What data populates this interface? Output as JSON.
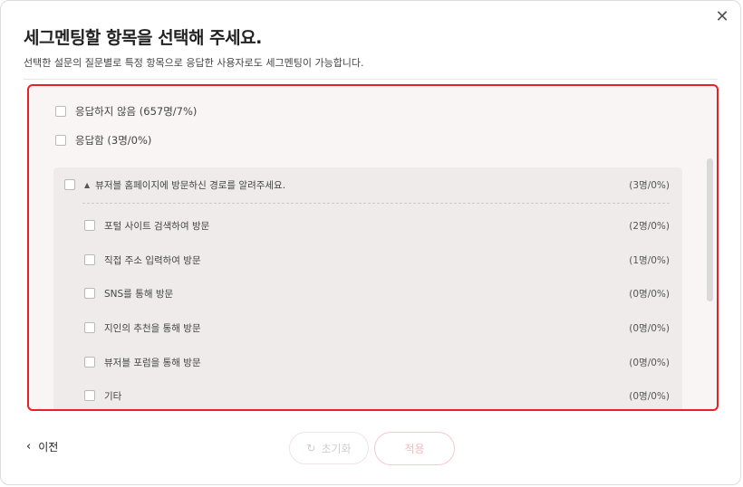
{
  "dialog": {
    "title": "세그멘팅할 항목을 선택해 주세요.",
    "subtitle": "선택한 설문의 질문별로 특정 항목으로 응답한 사용자로도 세그멘팅이 가능합니다.",
    "close_icon": "close-icon"
  },
  "options": [
    {
      "label": "응답하지 않음 (657명/7%)",
      "checked": false
    },
    {
      "label": "응답함 (3명/0%)",
      "checked": false
    }
  ],
  "group": {
    "question": "뷰저블 홈페이지에 방문하신 경로를 알려주세요.",
    "count": "(3명/0%)",
    "expanded": true,
    "items": [
      {
        "label": "포털 사이트 검색하여 방문",
        "count": "(2명/0%)",
        "checked": false
      },
      {
        "label": "직접 주소 입력하여 방문",
        "count": "(1명/0%)",
        "checked": false
      },
      {
        "label": "SNS를 통해 방문",
        "count": "(0명/0%)",
        "checked": false
      },
      {
        "label": "지인의 추천을 통해 방문",
        "count": "(0명/0%)",
        "checked": false
      },
      {
        "label": "뷰저블 포럼을 통해 방문",
        "count": "(0명/0%)",
        "checked": false
      },
      {
        "label": "기타",
        "count": "(0명/0%)",
        "checked": false
      }
    ]
  },
  "footer": {
    "prev_label": "이전",
    "reset_label": "초기화",
    "apply_label": "적용"
  },
  "colors": {
    "highlight_border": "#e8202a",
    "apply_text": "#f7b9bd"
  }
}
